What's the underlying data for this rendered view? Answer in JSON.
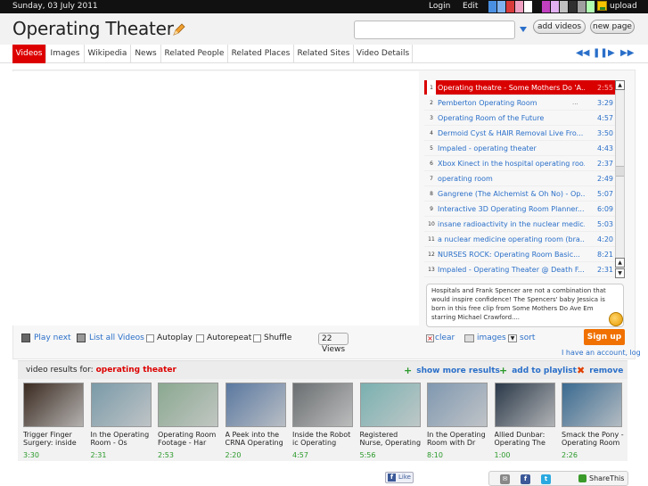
{
  "topbar": {
    "date": "Sunday, 03 July 2011",
    "login": "Login",
    "edit": "Edit",
    "upload": "upload",
    "swatch_colors": [
      "#4a90e2",
      "#7fb3f0",
      "#d93a3a",
      "#f0a0c0",
      "#ffffff",
      "#111111",
      "#c040c0",
      "#e0b0f0",
      "#c0c0c0",
      "#303030",
      "#a0a0a0",
      "#b0ffb0"
    ]
  },
  "header": {
    "title": "Operating Theater",
    "add_videos": "add videos",
    "new_page": "new page",
    "search_value": ""
  },
  "tabs": [
    "Videos",
    "Images",
    "Wikipedia",
    "News",
    "Related People",
    "Related Places",
    "Related Sites",
    "Video Details"
  ],
  "playlist": [
    {
      "n": "1",
      "title": "Operating theatre - Some Mothers Do 'A...",
      "dur": "2:55",
      "active": true
    },
    {
      "n": "2",
      "title": "Pemberton Operating Room",
      "dur": "3:29",
      "dots": true
    },
    {
      "n": "3",
      "title": "Operating Room of the Future",
      "dur": "4:57"
    },
    {
      "n": "4",
      "title": "Dermoid Cyst & HAIR Removal Live Fro...",
      "dur": "3:50"
    },
    {
      "n": "5",
      "title": "Impaled - operating theater",
      "dur": "4:43"
    },
    {
      "n": "6",
      "title": "Xbox Kinect in the hospital operating roo...",
      "dur": "2:37"
    },
    {
      "n": "7",
      "title": "operating room",
      "dur": "2:49"
    },
    {
      "n": "8",
      "title": "Gangrene (The Alchemist & Oh No) - Op...",
      "dur": "5:07"
    },
    {
      "n": "9",
      "title": "Interactive 3D Operating Room Planner...",
      "dur": "6:09"
    },
    {
      "n": "10",
      "title": "insane radioactivity in the nuclear medic...",
      "dur": "5:03"
    },
    {
      "n": "11",
      "title": "a nuclear medicine operating room (bra...",
      "dur": "4:20"
    },
    {
      "n": "12",
      "title": "NURSES ROCK: Operating Room Basic...",
      "dur": "8:21"
    },
    {
      "n": "13",
      "title": "Impaled - Operating Theater @ Death F...",
      "dur": "2:31"
    }
  ],
  "description": "Hospitals and Frank Spencer are not a combination that would inspire confidence! The Spencers' baby Jessica is born in this free clip from Some Mothers Do Ave Em starring Michael Crawford....",
  "controls": {
    "play_next": "Play next",
    "list_all": "List all Videos",
    "autoplay": "Autoplay",
    "autorepeat": "Autorepeat",
    "shuffle": "Shuffle",
    "views": "22 Views"
  },
  "sortbar": {
    "clear": "clear",
    "images": "images",
    "sort": "sort"
  },
  "signup": "Sign up",
  "account": "I have an account, log",
  "results": {
    "label": "video results for: ",
    "term": "operating theater",
    "show_more": "show more results",
    "add_playlist": "add to playlist",
    "remove": "remove"
  },
  "thumbs": [
    {
      "title": "Trigger Finger Surgery: inside",
      "dur": "3:30",
      "color": "#3a2a20"
    },
    {
      "title": "In the Operating Room - Os",
      "dur": "2:31",
      "color": "#7a9aa8"
    },
    {
      "title": "Operating Room Footage - Har",
      "dur": "2:53",
      "color": "#8aa890"
    },
    {
      "title": "A Peek into the CRNA Operating",
      "dur": "2:20",
      "color": "#5a78a0"
    },
    {
      "title": "Inside the Robot ic Operating",
      "dur": "4:57",
      "color": "#6a6e70"
    },
    {
      "title": "Registered Nurse, Operating",
      "dur": "5:56",
      "color": "#7ab0b0"
    },
    {
      "title": "In the Operating Room with Dr",
      "dur": "8:10",
      "color": "#8098b0"
    },
    {
      "title": "Allied Dunbar: Operating The",
      "dur": "1:00",
      "color": "#2a3848"
    },
    {
      "title": "Smack the Pony - Operating Room",
      "dur": "2:26",
      "color": "#3a6a90"
    }
  ],
  "social": {
    "like": "Like",
    "share": "ShareThis"
  }
}
